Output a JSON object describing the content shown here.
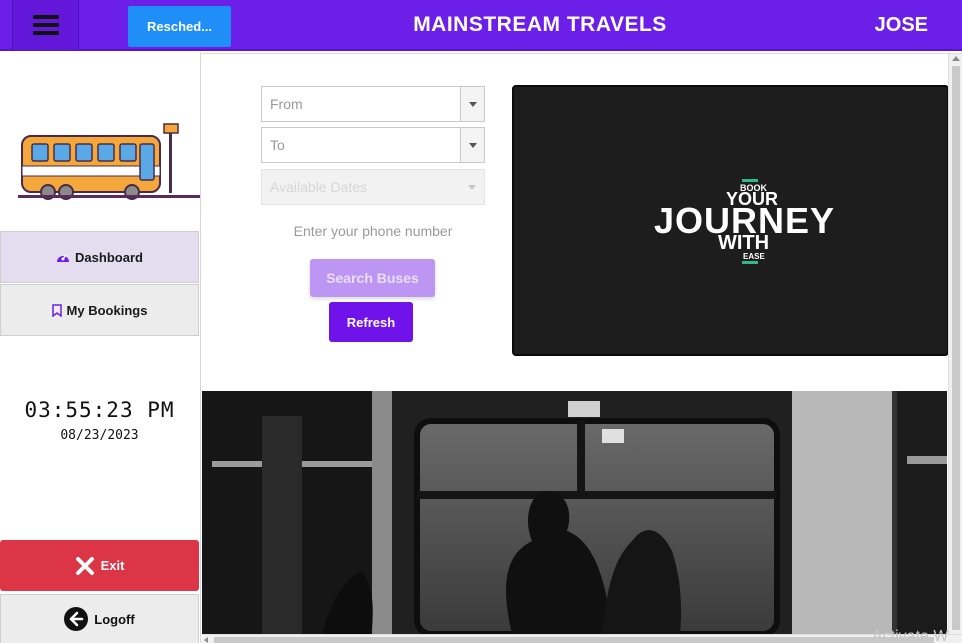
{
  "header": {
    "reschedule_label": "Resched...",
    "brand": "MAINSTREAM TRAVELS",
    "user": "JOSE"
  },
  "sidebar": {
    "items": [
      {
        "label": "Dashboard",
        "icon": "gauge-icon"
      },
      {
        "label": "My Bookings",
        "icon": "bookmark-icon"
      }
    ],
    "clock": "03:55:23 PM",
    "date": "08/23/2023",
    "exit_label": "Exit",
    "logoff_label": "Logoff"
  },
  "form": {
    "from_placeholder": "From",
    "to_placeholder": "To",
    "dates_placeholder": "Available Dates",
    "phone_placeholder": "Enter your phone number",
    "search_label": "Search Buses",
    "refresh_label": "Refresh"
  },
  "banner": {
    "line1": "BOOK",
    "line2": "YOUR",
    "line3": "JOURNEY",
    "line4": "WITH",
    "line5": "EASE"
  },
  "watermark": "Activate W",
  "colors": {
    "header": "#6c1fe8",
    "reschedule": "#1f8ff7",
    "search_disabled": "#bd95f3",
    "refresh": "#6f13ea",
    "exit": "#dc3545",
    "banner_accent": "#2fb88a"
  }
}
